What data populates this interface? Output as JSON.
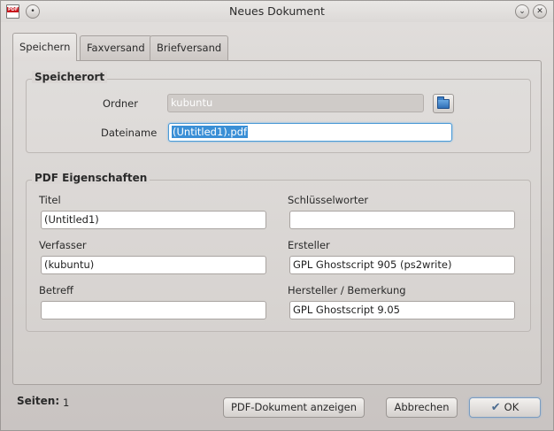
{
  "window": {
    "title": "Neues Dokument",
    "app_icon_text": "PDF"
  },
  "tabs": [
    {
      "label": "Speichern",
      "active": true
    },
    {
      "label": "Faxversand",
      "active": false
    },
    {
      "label": "Briefversand",
      "active": false
    }
  ],
  "speicherort": {
    "title": "Speicherort",
    "ordner_label": "Ordner",
    "ordner_value": "kubuntu",
    "dateiname_label": "Dateiname",
    "dateiname_value": "(Untitled1).pdf"
  },
  "pdf": {
    "title": "PDF Eigenschaften",
    "titel_label": "Titel",
    "titel_value": "(Untitled1)",
    "schluesselwoerter_label": "Schlüsselworter",
    "schluesselwoerter_value": "",
    "verfasser_label": "Verfasser",
    "verfasser_value": "(kubuntu)",
    "ersteller_label": "Ersteller",
    "ersteller_value": "GPL Ghostscript 905 (ps2write)",
    "betreff_label": "Betreff",
    "betreff_value": "",
    "hersteller_label": "Hersteller / Bemerkung",
    "hersteller_value": "GPL Ghostscript 9.05"
  },
  "footer": {
    "seiten_label": "Seiten:",
    "seiten_value": "1",
    "show_button": "PDF-Dokument anzeigen",
    "cancel_button": "Abbrechen",
    "ok_button": "OK"
  },
  "icons": {
    "app": "pdf-document-icon",
    "folder": "folder-icon",
    "ok": "checkmark-icon"
  }
}
